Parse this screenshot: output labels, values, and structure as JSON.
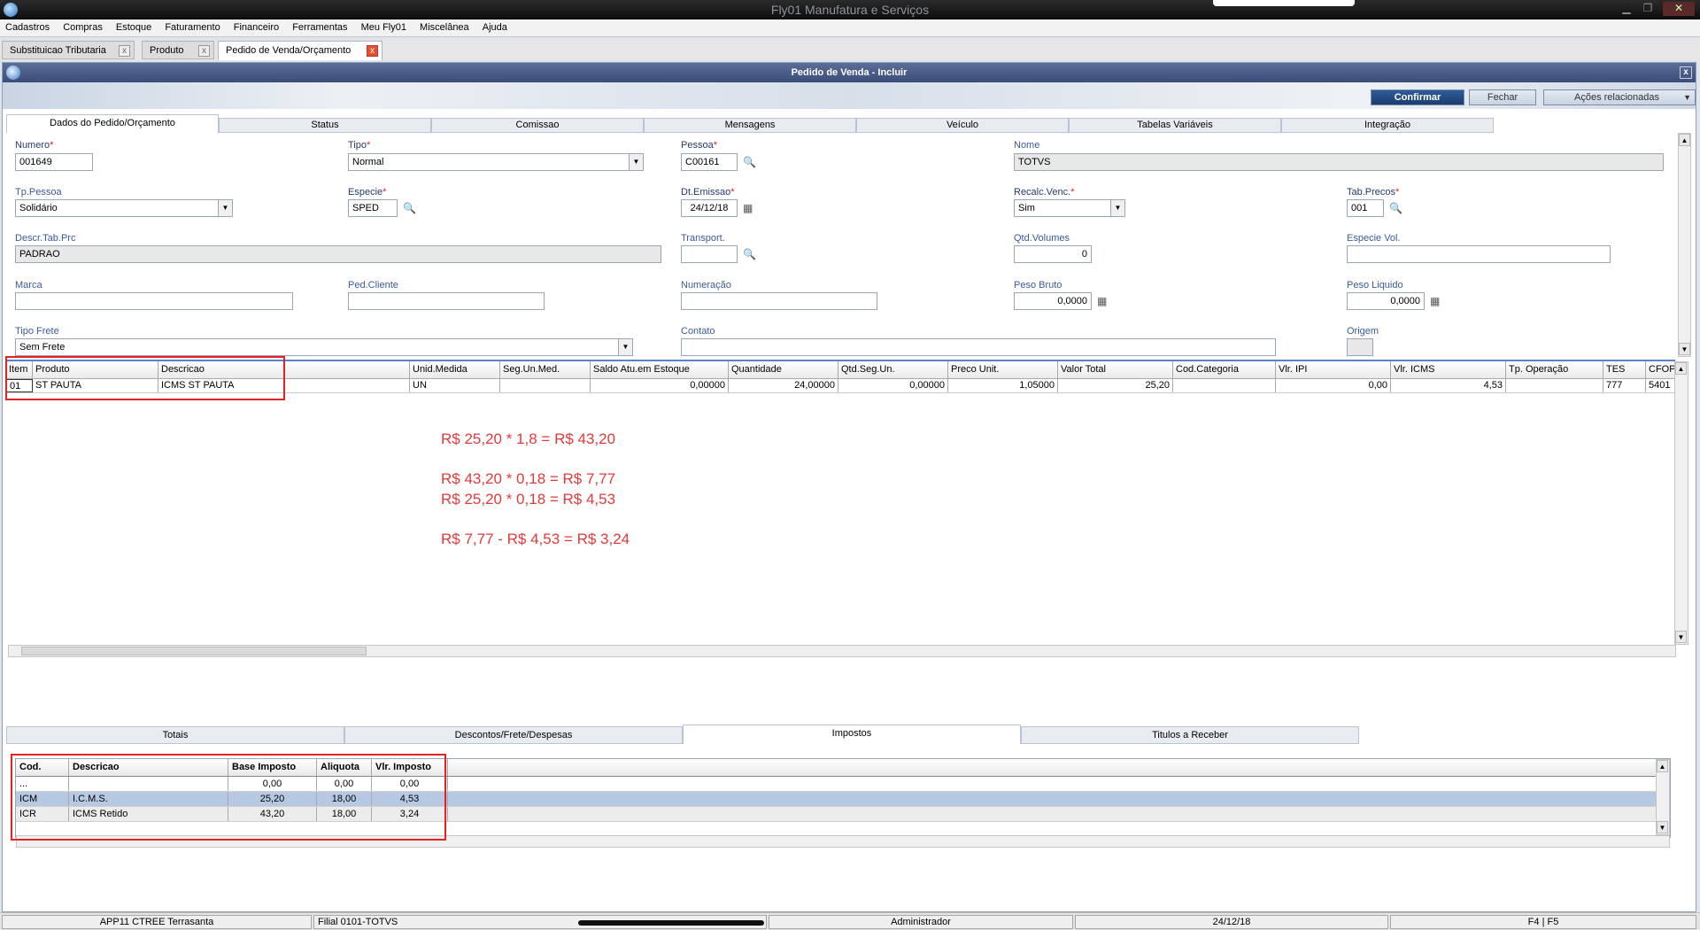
{
  "app": {
    "title": "Fly01 Manufatura e Serviços"
  },
  "menu": [
    "Cadastros",
    "Compras",
    "Estoque",
    "Faturamento",
    "Financeiro",
    "Ferramentas",
    "Meu Fly01",
    "Miscelânea",
    "Ajuda"
  ],
  "doc_tabs": [
    {
      "label": "Substituicao Tributaria",
      "close": "x"
    },
    {
      "label": "Produto",
      "close": "x"
    },
    {
      "label": "Pedido de Venda/Orçamento",
      "close": "x"
    }
  ],
  "window": {
    "title": "Pedido de Venda - Incluir",
    "close": "x"
  },
  "actions": {
    "confirm": "Confirmar",
    "close": "Fechar",
    "related": "Ações relacionadas"
  },
  "form_tabs": [
    "Dados do Pedido/Orçamento",
    "Status",
    "Comissao",
    "Mensagens",
    "Veículo",
    "Tabelas Variáveis",
    "Integração"
  ],
  "form": {
    "numero": {
      "label": "Numero",
      "value": "001649"
    },
    "tipo": {
      "label": "Tipo",
      "value": "Normal"
    },
    "pessoa": {
      "label": "Pessoa",
      "value": "C00161"
    },
    "nome": {
      "label": "Nome",
      "value": "TOTVS"
    },
    "tp_pessoa": {
      "label": "Tp.Pessoa",
      "value": "Solidário"
    },
    "especie": {
      "label": "Especie",
      "value": "SPED"
    },
    "dt_emissao": {
      "label": "Dt.Emissao",
      "value": "24/12/18"
    },
    "recalc_venc": {
      "label": "Recalc.Venc.",
      "value": "Sim"
    },
    "tab_precos": {
      "label": "Tab.Precos",
      "value": "001"
    },
    "descr_tab_prc": {
      "label": "Descr.Tab.Prc",
      "value": "PADRAO"
    },
    "transport": {
      "label": "Transport.",
      "value": ""
    },
    "qtd_volumes": {
      "label": "Qtd.Volumes",
      "value": "0"
    },
    "especie_vol": {
      "label": "Especie Vol.",
      "value": ""
    },
    "marca": {
      "label": "Marca",
      "value": ""
    },
    "ped_cliente": {
      "label": "Ped.Cliente",
      "value": ""
    },
    "numeracao": {
      "label": "Numeração",
      "value": ""
    },
    "peso_bruto": {
      "label": "Peso Bruto",
      "value": "0,0000"
    },
    "peso_liquido": {
      "label": "Peso Liquido",
      "value": "0,0000"
    },
    "tipo_frete": {
      "label": "Tipo Frete",
      "value": "Sem Frete"
    },
    "contato": {
      "label": "Contato",
      "value": ""
    },
    "origem": {
      "label": "Origem",
      "value": ""
    }
  },
  "items_grid": {
    "columns": [
      "Item",
      "Produto",
      "Descricao",
      "Unid.Medida",
      "Seg.Un.Med.",
      "Saldo Atu.em Estoque",
      "Quantidade",
      "Qtd.Seg.Un.",
      "Preco Unit.",
      "Valor Total",
      "Cod.Categoria",
      "Vlr. IPI",
      "Vlr. ICMS",
      "Tp. Operação",
      "TES",
      "CFOP"
    ],
    "rows": [
      [
        "01",
        "ST PAUTA",
        "ICMS ST PAUTA",
        "UN",
        "",
        "0,00000",
        "24,00000",
        "0,00000",
        "1,05000",
        "25,20",
        "",
        "0,00",
        "4,53",
        "",
        "777",
        "5401"
      ]
    ]
  },
  "annotations": [
    "R$ 25,20 * 1,8 = R$ 43,20",
    "R$ 43,20 * 0,18 = R$ 7,77",
    "R$ 25,20 * 0,18 = R$ 4,53",
    "R$ 7,77 - R$ 4,53 = R$ 3,24"
  ],
  "bottom_tabs": [
    "Totais",
    "Descontos/Frete/Despesas",
    "Impostos",
    "Titulos a Receber"
  ],
  "tax_grid": {
    "columns": [
      "Cod.",
      "Descricao",
      "Base Imposto",
      "Aliquota",
      "Vlr. Imposto"
    ],
    "rows": [
      [
        "...",
        "",
        "0,00",
        "0,00",
        "0,00"
      ],
      [
        "ICM",
        "I.C.M.S.",
        "25,20",
        "18,00",
        "4,53"
      ],
      [
        "ICR",
        "ICMS Retido",
        "43,20",
        "18,00",
        "3,24"
      ]
    ]
  },
  "status_bar": [
    "APP11    CTREE Terrasanta",
    "Filial 0101-TOTVS",
    "Administrador",
    "24/12/18",
    "F4 | F5"
  ],
  "icons": {
    "search": "magnifier-icon",
    "calendar": "calendar-icon",
    "calculator": "calculator-icon"
  },
  "colors": {
    "primary_button": "#1f4379",
    "annotation_red": "#e23a3a",
    "title_bar": "#3a4c78",
    "selected_row": "#b7c9e2"
  }
}
